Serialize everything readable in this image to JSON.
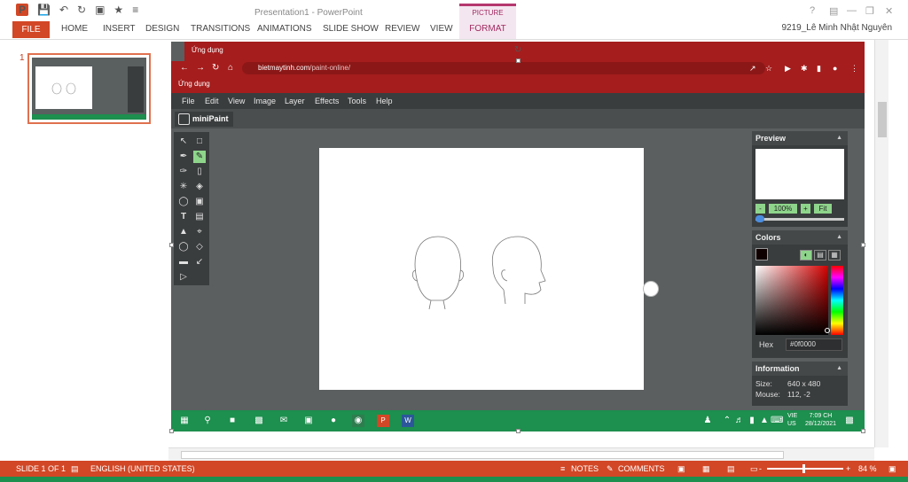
{
  "titlebar": {
    "doc_title": "Presentation1 - PowerPoint",
    "picture_tools": "PICTURE TOOLS",
    "ppt_logo": "P",
    "help": "?",
    "minimize": "—",
    "restore": "❐",
    "close": "✕"
  },
  "ribbon": {
    "tabs": [
      "FILE",
      "HOME",
      "INSERT",
      "DESIGN",
      "TRANSITIONS",
      "ANIMATIONS",
      "SLIDE SHOW",
      "REVIEW",
      "VIEW",
      "FORMAT"
    ],
    "user": "9219_Lê Minh Nhật Nguyên"
  },
  "thumbnails": {
    "slide_number": "1"
  },
  "browser": {
    "bookmark_apps": "Ứng dụng",
    "url_host": "bietmaytinh.com",
    "url_path": "/paint-online/"
  },
  "minipaint": {
    "menu": [
      "File",
      "Edit",
      "View",
      "Image",
      "Layer",
      "Effects",
      "Tools",
      "Help"
    ],
    "brand": "miniPaint",
    "preview": {
      "title": "Preview",
      "zoom_minus": "-",
      "zoom_value": "100%",
      "zoom_plus": "+",
      "zoom_fit": "Fit"
    },
    "colors": {
      "title": "Colors",
      "hex_label": "Hex",
      "hex_value": "#0f0000"
    },
    "information": {
      "title": "Information",
      "size_label": "Size:",
      "size_value": "640 x 480",
      "mouse_label": "Mouse:",
      "mouse_value": "112, -2"
    }
  },
  "taskbar": {
    "lang_1": "VIE",
    "lang_2": "US",
    "time": "7:09 CH",
    "date": "28/12/2021"
  },
  "statusbar": {
    "slide": "SLIDE 1 OF 1",
    "language": "ENGLISH (UNITED STATES)",
    "notes": "NOTES",
    "comments": "COMMENTS",
    "zoom_minus": "-",
    "zoom_plus": "+",
    "zoom": "84 %"
  },
  "colors": {
    "accent": "#d24726",
    "browser_bar": "#a51d1d",
    "taskbar": "#1d8f4e",
    "app_bg": "#5b5f60",
    "active_tool": "#8ed58b",
    "selected_color": "#0f0000"
  },
  "zoom_slider_fraction": 0.47
}
